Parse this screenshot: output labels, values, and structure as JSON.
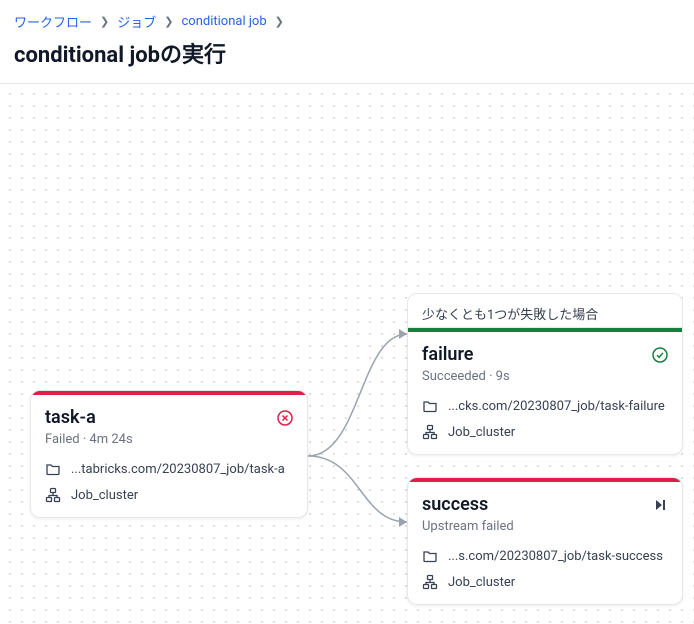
{
  "breadcrumb": {
    "workflow": "ワークフロー",
    "jobs": "ジョブ",
    "job_name": "conditional job"
  },
  "page_title": "conditional jobの実行",
  "nodes": {
    "task_a": {
      "title": "task-a",
      "status": "Failed · 4m 24s",
      "path": "...tabricks.com/20230807_job/task-a",
      "cluster": "Job_cluster"
    },
    "failure": {
      "condition_label": "少なくとも1つが失敗した場合",
      "title": "failure",
      "status": "Succeeded · 9s",
      "path": "...cks.com/20230807_job/task-failure",
      "cluster": "Job_cluster"
    },
    "success": {
      "title": "success",
      "status": "Upstream failed",
      "path": "...s.com/20230807_job/task-success",
      "cluster": "Job_cluster"
    }
  }
}
